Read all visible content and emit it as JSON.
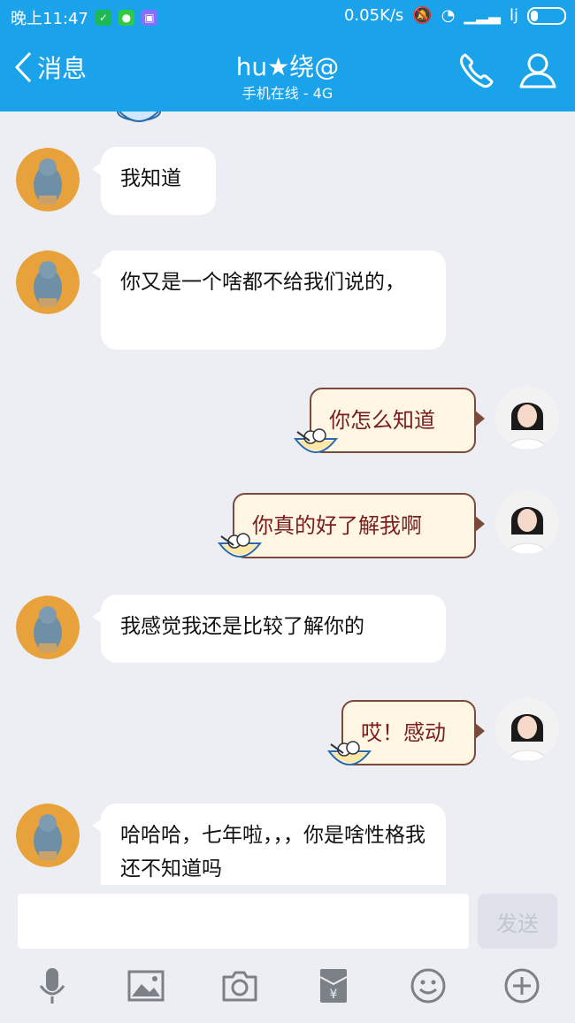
{
  "status_bar": {
    "time": "晚上11:47",
    "net_speed": "0.05K/s",
    "carrier": "lj"
  },
  "header": {
    "back_label": "消息",
    "title": "hu★绕@",
    "subtitle": "手机在线 - 4G"
  },
  "messages": [
    {
      "side": "left",
      "text": "我知道"
    },
    {
      "side": "left",
      "text": "你又是一个啥都不给我们说的，"
    },
    {
      "side": "right",
      "text": "你怎么知道"
    },
    {
      "side": "right",
      "text": "你真的好了解我啊"
    },
    {
      "side": "left",
      "text": "我感觉我还是比较了解你的"
    },
    {
      "side": "right",
      "text": "哎！感动"
    },
    {
      "side": "left",
      "text": "哈哈哈，七年啦，，，你是啥性格我还不知道吗"
    }
  ],
  "input": {
    "send_label": "发送"
  },
  "toolbar": [
    "microphone-icon",
    "image-icon",
    "camera-icon",
    "red-packet-icon",
    "emoji-icon",
    "plus-icon"
  ]
}
